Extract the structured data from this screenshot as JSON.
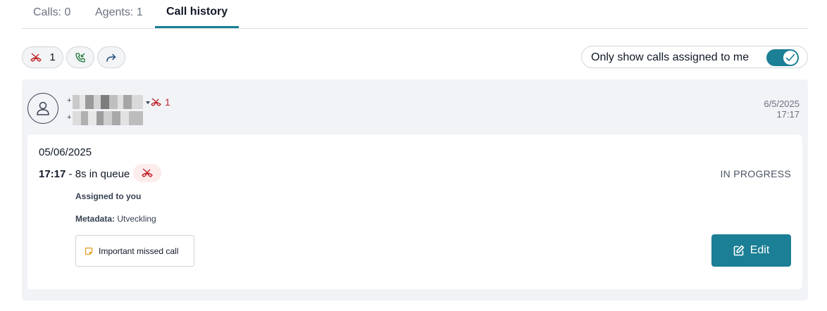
{
  "tabs": {
    "calls": "Calls: 0",
    "agents": "Agents: 1",
    "history": "Call history"
  },
  "filters": {
    "missed_count": "1",
    "assigned_label": "Only show calls assigned to me",
    "assigned_toggle_on": true
  },
  "call": {
    "plus_sign": "+",
    "missed_count": "1",
    "date": "6/5/2025",
    "time": "17:17",
    "detail": {
      "date": "05/06/2025",
      "time": "17:17",
      "queue_text": " - 8s in queue",
      "status": "IN PROGRESS",
      "assigned": "Assigned to you",
      "metadata_label": "Metadata:",
      "metadata_value": "Utveckling",
      "note": "Important missed call",
      "edit_label": "Edit"
    }
  },
  "colors": {
    "accent": "#1b7f95",
    "missed_red": "#c0262d",
    "incoming_green": "#1f7a3a",
    "forward_blue": "#1f4e79",
    "note_orange": "#e0a020"
  },
  "icons": {
    "missed": "missed-call-icon",
    "incoming": "incoming-call-icon",
    "forward": "forward-icon",
    "avatar": "user-icon",
    "note": "sticky-note-icon",
    "edit": "edit-icon",
    "check": "check-icon"
  }
}
